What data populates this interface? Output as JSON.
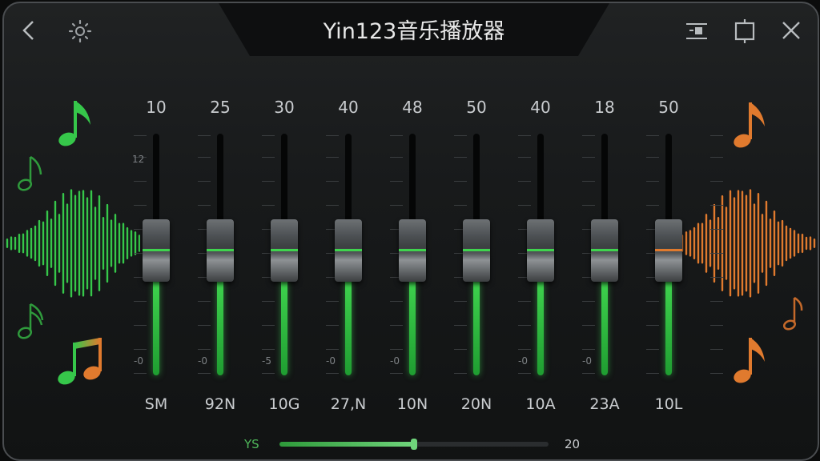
{
  "window": {
    "title": "Yin123音乐播放器"
  },
  "icons": {
    "back": "chevron-left-icon",
    "settings": "gear-icon",
    "mini_mode": "mini-mode-icon",
    "maximize": "maximize-icon",
    "close": "close-icon"
  },
  "equalizer": {
    "scale_labels": [
      "12",
      "-0",
      "-0",
      "-5",
      "-0",
      "-0",
      "-0",
      "-0"
    ],
    "bands": [
      {
        "value": "10",
        "label": "SM",
        "level": 0.4
      },
      {
        "value": "25",
        "label": "92N",
        "level": 0.4
      },
      {
        "value": "30",
        "label": "10G",
        "level": 0.4
      },
      {
        "value": "40",
        "label": "27,N",
        "level": 0.4
      },
      {
        "value": "48",
        "label": "10N",
        "level": 0.4
      },
      {
        "value": "50",
        "label": "20N",
        "level": 0.4
      },
      {
        "value": "40",
        "label": "10A",
        "level": 0.4
      },
      {
        "value": "18",
        "label": "23A",
        "level": 0.4
      },
      {
        "value": "50",
        "label": "10L",
        "level": 0.4
      }
    ]
  },
  "bottom_slider": {
    "label": "YS",
    "value": "20",
    "fraction": 0.5
  },
  "colors": {
    "accent_green": "#3fd44e",
    "accent_orange": "#e07a2e",
    "background": "#181a1b"
  }
}
